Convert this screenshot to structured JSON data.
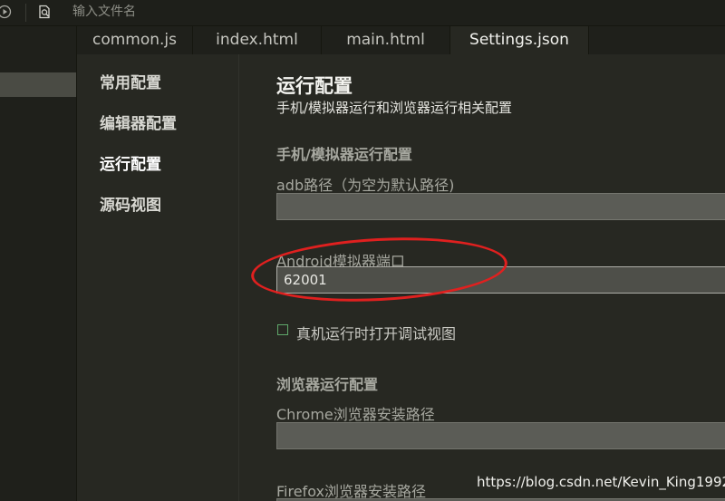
{
  "toolbar": {
    "search_placeholder": "输入文件名",
    "run_icon": "run-circle-icon",
    "find_icon": "document-search-icon"
  },
  "tabs": [
    {
      "label": "common.js",
      "active": false
    },
    {
      "label": "index.html",
      "active": false
    },
    {
      "label": "main.html",
      "active": false
    },
    {
      "label": "Settings.json",
      "active": true
    }
  ],
  "nav": {
    "items": [
      {
        "label": "常用配置",
        "active": false
      },
      {
        "label": "编辑器配置",
        "active": false
      },
      {
        "label": "运行配置",
        "active": true
      },
      {
        "label": "源码视图",
        "active": false
      }
    ]
  },
  "content": {
    "title": "运行配置",
    "subtitle": "手机/模拟器运行和浏览器运行相关配置",
    "sections": [
      {
        "title": "手机/模拟器运行配置",
        "fields": [
          {
            "label": "adb路径（为空为默认路径)",
            "value": ""
          },
          {
            "label": "Android模拟器端口",
            "value": "62001"
          }
        ],
        "checkbox": {
          "label": "真机运行时打开调试视图",
          "checked": false
        }
      },
      {
        "title": "浏览器运行配置",
        "fields": [
          {
            "label": "Chrome浏览器安装路径",
            "value": ""
          },
          {
            "label": "Firefox浏览器安装路径",
            "value": ""
          }
        ]
      }
    ]
  },
  "colors": {
    "background": "#272822",
    "annotation": "#e0201f",
    "checkbox_border": "#5fa86a"
  },
  "watermark": "https://blog.csdn.net/Kevin_King1992"
}
